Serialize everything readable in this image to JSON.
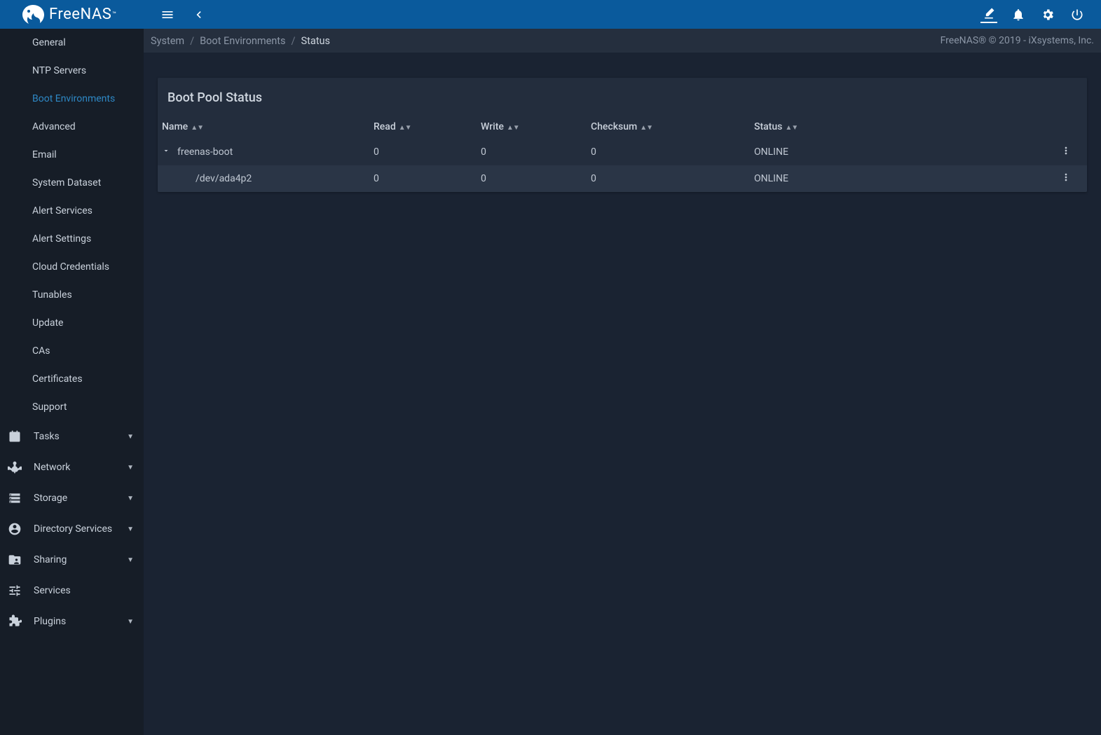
{
  "brand": "FreeNAS",
  "breadcrumbs": [
    "System",
    "Boot Environments",
    "Status"
  ],
  "copyright": "FreeNAS® © 2019 - iXsystems, Inc.",
  "sidebar": {
    "sub_items": [
      {
        "label": "General",
        "active": false
      },
      {
        "label": "NTP Servers",
        "active": false
      },
      {
        "label": "Boot Environments",
        "active": true
      },
      {
        "label": "Advanced",
        "active": false
      },
      {
        "label": "Email",
        "active": false
      },
      {
        "label": "System Dataset",
        "active": false
      },
      {
        "label": "Alert Services",
        "active": false
      },
      {
        "label": "Alert Settings",
        "active": false
      },
      {
        "label": "Cloud Credentials",
        "active": false
      },
      {
        "label": "Tunables",
        "active": false
      },
      {
        "label": "Update",
        "active": false
      },
      {
        "label": "CAs",
        "active": false
      },
      {
        "label": "Certificates",
        "active": false
      },
      {
        "label": "Support",
        "active": false
      }
    ],
    "sections": [
      {
        "label": "Tasks",
        "icon": "calendar"
      },
      {
        "label": "Network",
        "icon": "hub"
      },
      {
        "label": "Storage",
        "icon": "storage"
      },
      {
        "label": "Directory Services",
        "icon": "dirsvc"
      },
      {
        "label": "Sharing",
        "icon": "folder-shared"
      },
      {
        "label": "Services",
        "icon": "tune"
      },
      {
        "label": "Plugins",
        "icon": "extension"
      }
    ]
  },
  "card": {
    "title": "Boot Pool Status",
    "columns": [
      "Name",
      "Read",
      "Write",
      "Checksum",
      "Status"
    ],
    "rows": [
      {
        "name": "freenas-boot",
        "read": "0",
        "write": "0",
        "checksum": "0",
        "status": "ONLINE",
        "expandable": true,
        "indent": 0
      },
      {
        "name": "/dev/ada4p2",
        "read": "0",
        "write": "0",
        "checksum": "0",
        "status": "ONLINE",
        "expandable": false,
        "indent": 1
      }
    ]
  }
}
